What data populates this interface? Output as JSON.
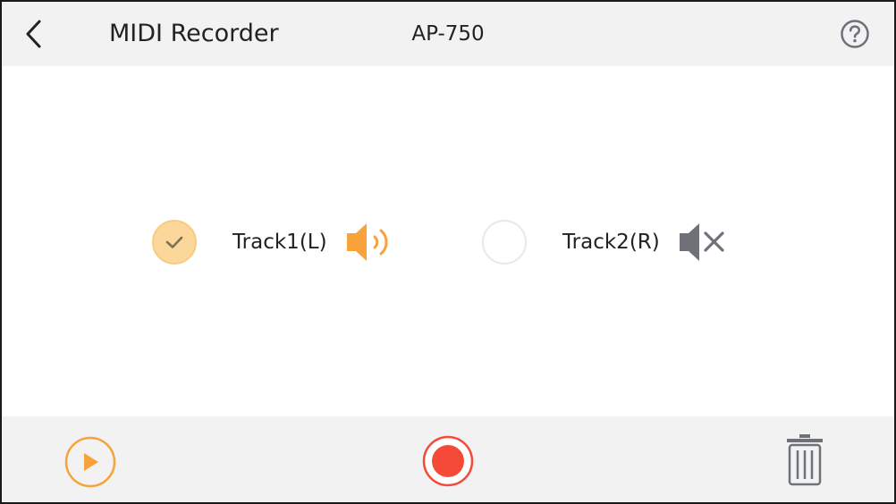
{
  "header": {
    "back_icon": "chevron-left-icon",
    "title": "MIDI Recorder",
    "device": "AP-750",
    "help_icon": "question-circle-icon"
  },
  "tracks": [
    {
      "label": "Track1(L)",
      "selected": true,
      "muted": false,
      "speaker_icon": "speaker-on-icon"
    },
    {
      "label": "Track2(R)",
      "selected": false,
      "muted": true,
      "speaker_icon": "speaker-muted-icon"
    }
  ],
  "footer": {
    "play_icon": "play-icon",
    "record_icon": "record-icon",
    "delete_icon": "trash-icon"
  },
  "colors": {
    "accent_orange": "#f7a23b",
    "record_red": "#f44a37",
    "check_fill": "#fbd79a",
    "muted_gray": "#6f7179",
    "bar_bg": "#f2f2f2"
  }
}
